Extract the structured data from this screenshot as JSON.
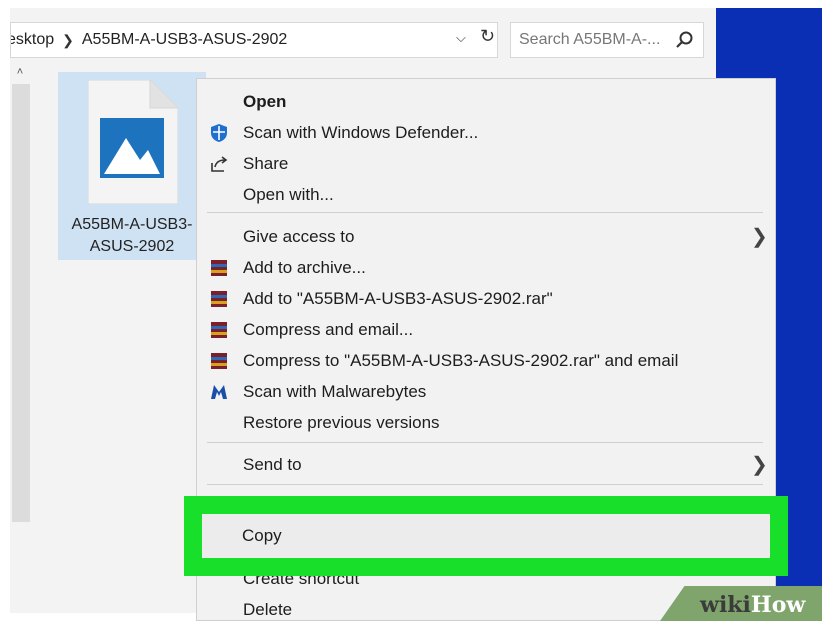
{
  "address_bar": {
    "crumb_prefix": "esktop",
    "crumb_folder": "A55BM-A-USB3-ASUS-2902"
  },
  "search": {
    "placeholder": "Search A55BM-A-..."
  },
  "file": {
    "name_line1": "A55BM-A-USB3-",
    "name_line2": "ASUS-2902",
    "icon": "image-file-icon"
  },
  "context_menu": {
    "items": [
      {
        "label": "Open",
        "icon": null,
        "bold": true
      },
      {
        "label": "Scan with Windows Defender...",
        "icon": "windows-defender-shield-icon"
      },
      {
        "label": "Share",
        "icon": "share-icon"
      },
      {
        "label": "Open with...",
        "icon": null
      },
      {
        "label": "Give access to",
        "icon": null,
        "submenu": true
      },
      {
        "label": "Add to archive...",
        "icon": "winrar-icon"
      },
      {
        "label": "Add to \"A55BM-A-USB3-ASUS-2902.rar\"",
        "icon": "winrar-icon"
      },
      {
        "label": "Compress and email...",
        "icon": "winrar-icon"
      },
      {
        "label": "Compress to \"A55BM-A-USB3-ASUS-2902.rar\" and email",
        "icon": "winrar-icon"
      },
      {
        "label": "Scan with Malwarebytes",
        "icon": "malwarebytes-icon"
      },
      {
        "label": "Restore previous versions",
        "icon": null
      },
      {
        "label": "Send to",
        "icon": null,
        "submenu": true
      },
      {
        "label": "Copy",
        "icon": null,
        "highlighted": true
      },
      {
        "label": "Create shortcut",
        "icon": null
      },
      {
        "label": "Delete",
        "icon": null
      }
    ]
  },
  "watermark": {
    "part1": "wiki",
    "part2": "How"
  },
  "colors": {
    "highlight": "#18e02a",
    "desktop": "#0a2fb5",
    "selection": "#cfe2f3",
    "image_icon": "#1e73be"
  }
}
